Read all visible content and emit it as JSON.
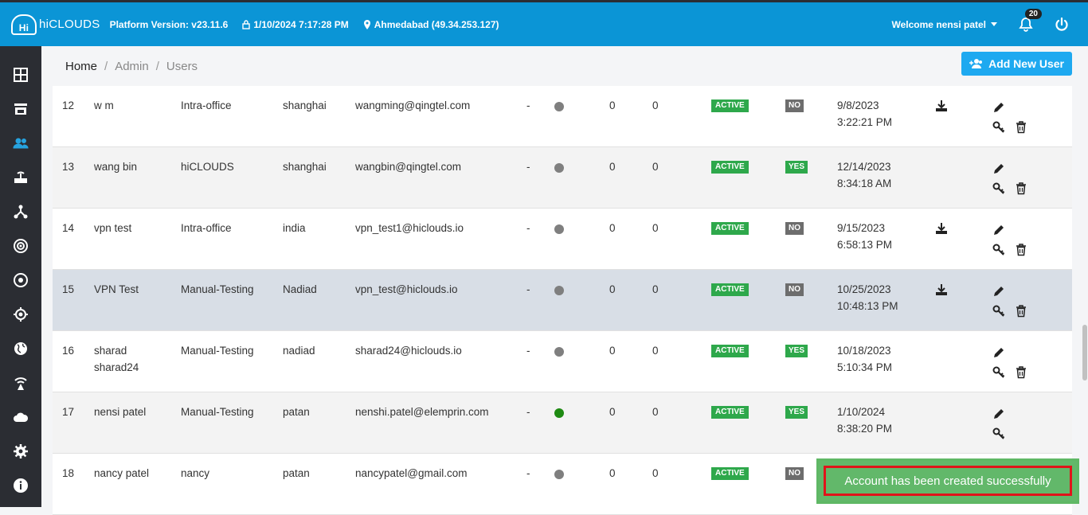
{
  "header": {
    "logo_text": "hiCLOUDS",
    "platform_version": "Platform Version: v23.11.6",
    "datetime": "1/10/2024 7:17:28 PM",
    "location": "Ahmedabad (49.34.253.127)",
    "welcome": "Welcome nensi patel",
    "notifications_count": "20"
  },
  "breadcrumb": [
    "Home",
    "Admin",
    "Users"
  ],
  "add_button_label": "Add New User",
  "rows": [
    {
      "id": "12",
      "name": "w m",
      "group": "Intra-office",
      "location": "shanghai",
      "email": "wangming@qingtel.com",
      "dash": "-",
      "online": false,
      "n1": "0",
      "n2": "0",
      "status": "ACTIVE",
      "vpn": "NO",
      "date": "9/8/2023",
      "time": "3:22:21 PM",
      "download": true
    },
    {
      "id": "13",
      "name": "wang bin",
      "group": "hiCLOUDS",
      "location": "shanghai",
      "email": "wangbin@qingtel.com",
      "dash": "-",
      "online": false,
      "n1": "0",
      "n2": "0",
      "status": "ACTIVE",
      "vpn": "YES",
      "date": "12/14/2023",
      "time": "8:34:18 AM",
      "download": false
    },
    {
      "id": "14",
      "name": "vpn test",
      "group": "Intra-office",
      "location": "india",
      "email": "vpn_test1@hiclouds.io",
      "dash": "-",
      "online": false,
      "n1": "0",
      "n2": "0",
      "status": "ACTIVE",
      "vpn": "NO",
      "date": "9/15/2023",
      "time": "6:58:13 PM",
      "download": true
    },
    {
      "id": "15",
      "name": "VPN Test",
      "group": "Manual-Testing",
      "location": "Nadiad",
      "email": "vpn_test@hiclouds.io",
      "dash": "-",
      "online": false,
      "n1": "0",
      "n2": "0",
      "status": "ACTIVE",
      "vpn": "NO",
      "date": "10/25/2023",
      "time": "10:48:13 PM",
      "download": true
    },
    {
      "id": "16",
      "name": "sharad sharad24",
      "group": "Manual-Testing",
      "location": "nadiad",
      "email": "sharad24@hiclouds.io",
      "dash": "-",
      "online": false,
      "n1": "0",
      "n2": "0",
      "status": "ACTIVE",
      "vpn": "YES",
      "date": "10/18/2023",
      "time": "5:10:34 PM",
      "download": false
    },
    {
      "id": "17",
      "name": "nensi patel",
      "group": "Manual-Testing",
      "location": "patan",
      "email": "nenshi.patel@elemprin.com",
      "dash": "-",
      "online": true,
      "n1": "0",
      "n2": "0",
      "status": "ACTIVE",
      "vpn": "YES",
      "date": "1/10/2024",
      "time": "8:38:20 PM",
      "download": false
    },
    {
      "id": "18",
      "name": "nancy patel",
      "group": "nancy",
      "location": "patan",
      "email": "nancypatel@gmail.com",
      "dash": "-",
      "online": false,
      "n1": "0",
      "n2": "0",
      "status": "ACTIVE",
      "vpn": "NO",
      "date": "",
      "time": "",
      "download": false
    }
  ],
  "toast": "Account has been created successfully",
  "colors": {
    "header": "#0b95d6",
    "sidebar": "#2b2d33",
    "active": "#2ea84b",
    "no": "#6d6d6d",
    "online": "#1e8a12",
    "toast_border": "#e0141a"
  }
}
